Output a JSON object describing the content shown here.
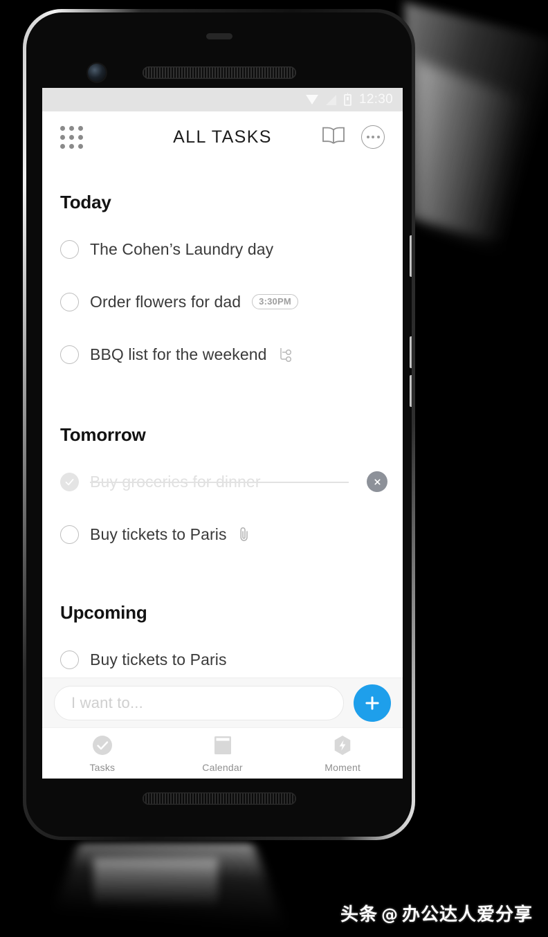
{
  "status_bar": {
    "time": "12:30",
    "icons": [
      "wifi-icon",
      "signal-icon",
      "battery-icon"
    ]
  },
  "app_bar": {
    "menu_icon": "grid-menu-icon",
    "title": "ALL TASKS",
    "book_icon": "open-book-icon",
    "more_icon": "more-options-icon"
  },
  "sections": [
    {
      "title": "Today",
      "tasks": [
        {
          "text": "The Cohen’s Laundry day",
          "completed": false,
          "badge": null,
          "icon": null
        },
        {
          "text": "Order flowers for dad",
          "completed": false,
          "badge": "3:30PM",
          "icon": null
        },
        {
          "text": "BBQ list for the weekend",
          "completed": false,
          "badge": null,
          "icon": "subtask-icon"
        }
      ]
    },
    {
      "title": "Tomorrow",
      "tasks": [
        {
          "text": "Buy groceries for dinner",
          "completed": true,
          "badge": null,
          "icon": "delete-icon"
        },
        {
          "text": "Buy tickets to Paris",
          "completed": false,
          "badge": null,
          "icon": "attachment-icon"
        }
      ]
    },
    {
      "title": "Upcoming",
      "tasks": [
        {
          "text": "Buy tickets to Paris",
          "completed": false,
          "badge": null,
          "icon": null
        }
      ]
    }
  ],
  "composer": {
    "placeholder": "I want to...",
    "add_button_icon": "plus-icon",
    "accent_color": "#1e9feb"
  },
  "tab_bar": {
    "tabs": [
      {
        "label": "Tasks",
        "icon": "check-circle-icon"
      },
      {
        "label": "Calendar",
        "icon": "notebook-icon"
      },
      {
        "label": "Moment",
        "icon": "hexagon-bolt-icon"
      }
    ]
  },
  "watermark": {
    "source": "头条",
    "at": "@",
    "account": "办公达人爱分享"
  }
}
